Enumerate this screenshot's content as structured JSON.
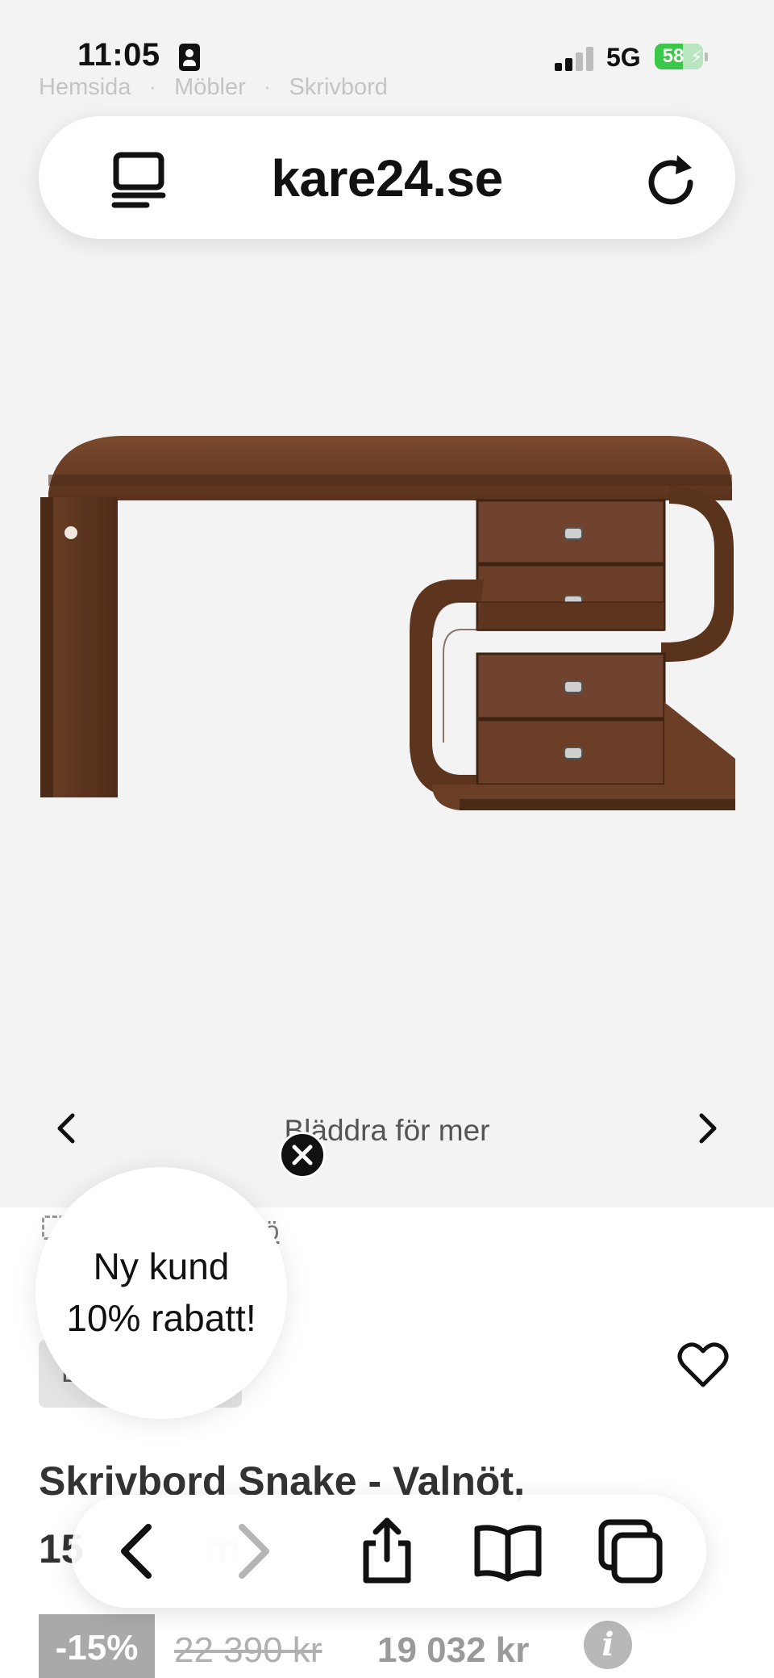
{
  "status_bar": {
    "time": "11:05",
    "network": "5G",
    "battery": "58"
  },
  "breadcrumb": {
    "items": [
      "Hemsida",
      "Möbler",
      "Skrivbord"
    ],
    "separator": "·"
  },
  "browser": {
    "url": "kare24.se"
  },
  "gallery": {
    "hint": "Bläddra för mer"
  },
  "product": {
    "feature_text": "ö",
    "box_label": "L",
    "title": "Skrivbord Snake - Valnöt,",
    "subtitle_partial": "15",
    "subtitle_end": "m",
    "discount": "-15%",
    "old_price": "22 390 kr",
    "price": "19 032 kr",
    "info_glyph": "i"
  },
  "promo": {
    "line1": "Ny kund",
    "line2": "10% rabatt!"
  },
  "colors": {
    "wood": "#6b3f26",
    "wood_dark": "#4a2a17",
    "background": "#f3f3f3",
    "battery_green": "#3ac74a"
  },
  "icons": [
    "id-badge-icon",
    "signal-icon",
    "battery-icon",
    "reader-icon",
    "reload-icon",
    "chevron-left-icon",
    "chevron-right-icon",
    "close-icon",
    "expand-icon",
    "heart-icon",
    "back-icon",
    "forward-icon",
    "share-icon",
    "bookmarks-icon",
    "tabs-icon",
    "info-icon"
  ]
}
